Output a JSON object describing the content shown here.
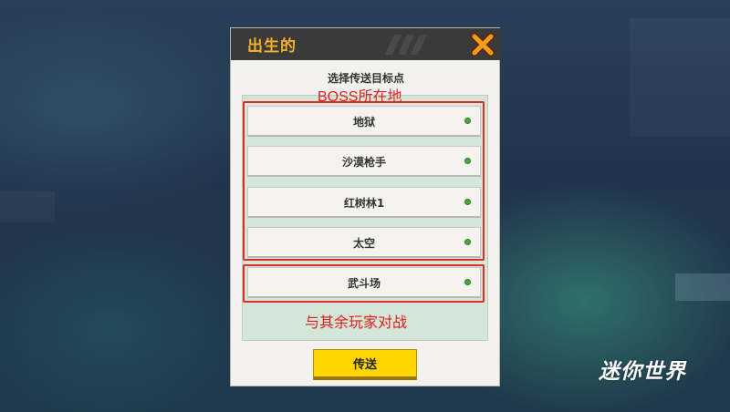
{
  "dialog": {
    "title": "出生的",
    "subtitle": "选择传送目标点",
    "destinations": [
      {
        "label": "地狱"
      },
      {
        "label": "沙漠枪手"
      },
      {
        "label": "红树林1"
      },
      {
        "label": "太空"
      },
      {
        "label": "武斗场"
      }
    ],
    "teleport_label": "传送"
  },
  "annotations": {
    "boss_note": "BOSS所在地",
    "pvp_note": "与其余玩家对战"
  },
  "logo": {
    "text": "迷你世界"
  },
  "colors": {
    "header": "#3a3a3a",
    "title": "#f3b12a",
    "close_x": "#f39a1f",
    "panel": "#d3e6d8",
    "status_dot": "#46a83a",
    "button": "#ffd400",
    "annotation": "#e0201e"
  },
  "icons": {
    "close": "close-x-icon",
    "status": "status-dot-icon"
  }
}
